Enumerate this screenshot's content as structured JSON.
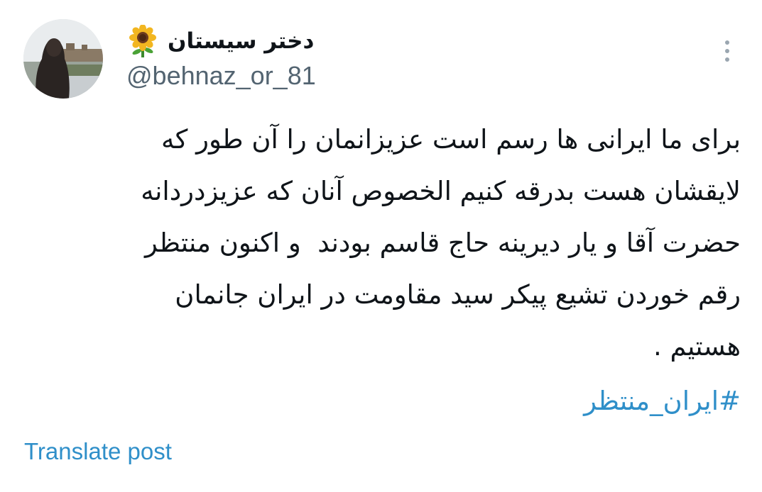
{
  "author": {
    "display_name": "دختر سیستان",
    "handle": "@behnaz_or_81",
    "name_emoji_icon": "sunflower-icon",
    "avatar_icon": "avatar-photo"
  },
  "menu": {
    "icon": "more-vertical-icon"
  },
  "tweet": {
    "lines": [
      "برای ما ایرانی ها رسم است عزیزانمان را آن طور که",
      "لایقشان هست بدرقه کنیم الخصوص آنان که عزیزدردانه",
      "حضرت آقا و یار دیرینه حاج قاسم بودند  و اکنون منتظر",
      "رقم خوردن تشیع پیکر سید مقاومت در ایران جانمان",
      "هستیم ."
    ],
    "hashtag": "#ایران_منتظر"
  },
  "actions": {
    "translate_label": "Translate post"
  },
  "colors": {
    "text": "#0f1419",
    "secondary_text": "#536471",
    "link": "#2f8fc9"
  }
}
